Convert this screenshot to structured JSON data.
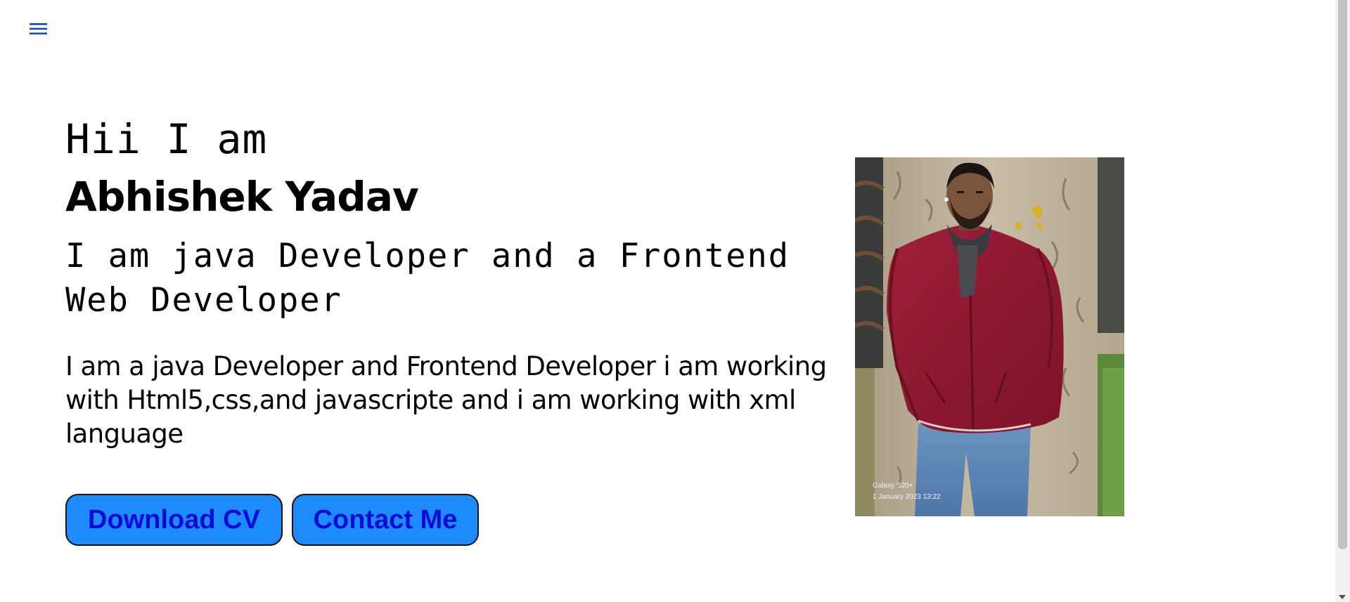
{
  "nav": {
    "menu_icon": "hamburger-menu-icon",
    "menu_color": "#1a4aa6"
  },
  "hero": {
    "greeting": "Hii I am",
    "name": "Abhishek Yadav",
    "role": "I am java Developer and a Frontend Web Developer",
    "description": "I am a java Developer and Frontend Developer i am working with Html5,css,and javascripte and i am working with xml language",
    "download_button": "Download CV",
    "contact_button": "Contact Me",
    "button_color": "#1e8bfd",
    "button_text_color": "#0b0bd8"
  },
  "photo": {
    "caption_line1": "Galaxy S20+",
    "caption_line2": "1 January 2023 13:22"
  }
}
